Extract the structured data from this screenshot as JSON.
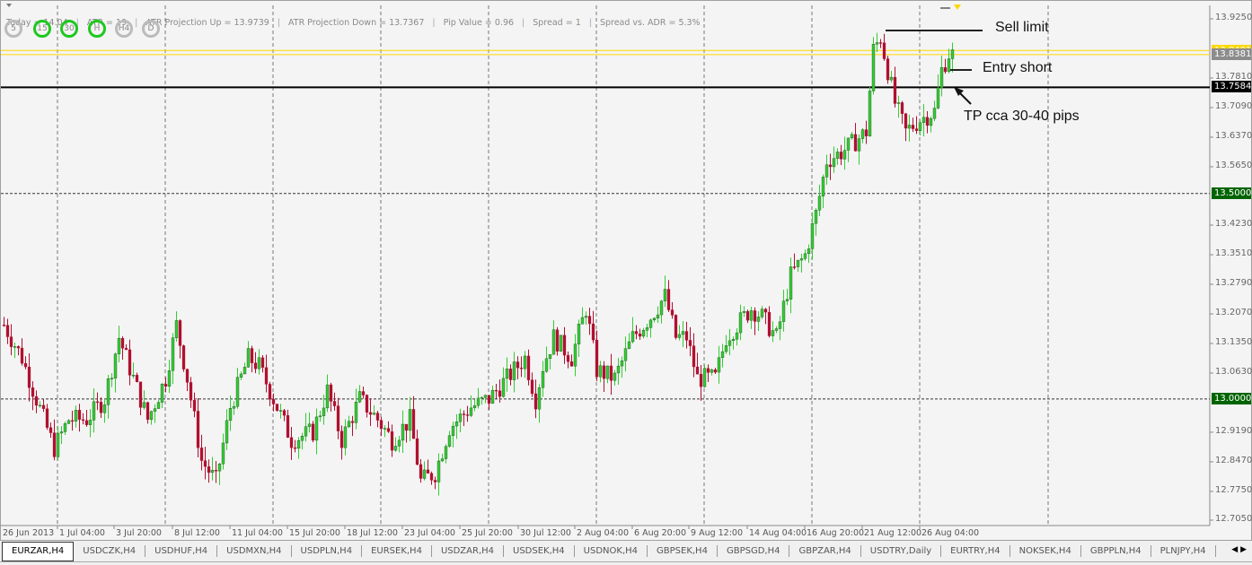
{
  "info_bar": {
    "today": "Today = 14.04",
    "atr": "ATR = 19",
    "atr_up": "ATR Projection Up = 13.9739",
    "atr_down": "ATR Projection Down = 13.7367",
    "pip_value": "Pip Value = 0.96",
    "spread": "Spread = 1",
    "spread_adr": "Spread vs. ADR = 5.3%"
  },
  "timeframes": [
    {
      "label": "5",
      "active": false
    },
    {
      "label": "15",
      "active": true
    },
    {
      "label": "30",
      "active": true
    },
    {
      "label": "H",
      "active": true
    },
    {
      "label": "H4",
      "active": false
    },
    {
      "label": "D",
      "active": false
    }
  ],
  "price_axis": [
    "13.9250",
    "13.7810",
    "13.7090",
    "13.6370",
    "13.5650",
    "13.4230",
    "13.3510",
    "13.2790",
    "13.2070",
    "13.1350",
    "13.0630",
    "12.9190",
    "12.8470",
    "12.7750",
    "12.7050"
  ],
  "price_markers": {
    "ask": "13.8481",
    "bid": "13.8381",
    "tp": "13.7584",
    "level_1": "13.5000",
    "level_2": "13.0000"
  },
  "time_axis": [
    "26 Jun 2013",
    "1 Jul 04:00",
    "3 Jul 20:00",
    "8 Jul 12:00",
    "11 Jul 04:00",
    "15 Jul 20:00",
    "18 Jul 12:00",
    "23 Jul 04:00",
    "25 Jul 20:00",
    "30 Jul 12:00",
    "2 Aug 04:00",
    "6 Aug 20:00",
    "9 Aug 12:00",
    "14 Aug 04:00",
    "16 Aug 20:00",
    "21 Aug 12:00",
    "26 Aug 04:00"
  ],
  "annotations": {
    "sell_limit": "Sell limit",
    "entry_short": "Entry short",
    "tp": "TP cca 30-40 pips"
  },
  "colors": {
    "bull": "#32cd32",
    "bear": "#b01030",
    "ask_line": "#ffd700",
    "tp_line": "#000000",
    "level_bg": "#006400"
  },
  "tabs": [
    "EURZAR,H4",
    "USDCZK,H4",
    "USDHUF,H4",
    "USDMXN,H4",
    "USDPLN,H4",
    "EURSEK,H4",
    "USDZAR,H4",
    "USDSEK,H4",
    "USDNOK,H4",
    "GBPSEK,H4",
    "GBPSGD,H4",
    "GBPZAR,H4",
    "USDTRY,Daily",
    "EURTRY,H4",
    "NOKSEK,H4",
    "GBPPLN,H4",
    "PLNJPY,H4"
  ],
  "chart_data": {
    "type": "candlestick",
    "symbol": "EURZAR",
    "timeframe": "H4",
    "ylim": [
      12.705,
      13.925
    ],
    "close_path": [
      [
        0,
        13.18
      ],
      [
        5,
        13.1
      ],
      [
        9,
        13.0
      ],
      [
        14,
        12.88
      ],
      [
        18,
        12.95
      ],
      [
        23,
        12.95
      ],
      [
        28,
        13.0
      ],
      [
        32,
        13.15
      ],
      [
        36,
        13.05
      ],
      [
        40,
        12.95
      ],
      [
        45,
        13.05
      ],
      [
        48,
        13.18
      ],
      [
        51,
        13.05
      ],
      [
        55,
        12.85
      ],
      [
        59,
        12.8
      ],
      [
        63,
        12.98
      ],
      [
        68,
        13.1
      ],
      [
        71,
        13.08
      ],
      [
        75,
        13.0
      ],
      [
        80,
        12.9
      ],
      [
        86,
        12.92
      ],
      [
        90,
        13.02
      ],
      [
        94,
        12.9
      ],
      [
        99,
        13.0
      ],
      [
        104,
        12.95
      ],
      [
        108,
        12.9
      ],
      [
        113,
        12.95
      ],
      [
        116,
        12.8
      ],
      [
        120,
        12.82
      ],
      [
        124,
        12.93
      ],
      [
        130,
        12.98
      ],
      [
        135,
        13.0
      ],
      [
        140,
        13.05
      ],
      [
        145,
        13.1
      ],
      [
        148,
        13.0
      ],
      [
        150,
        13.08
      ],
      [
        153,
        13.15
      ],
      [
        158,
        13.1
      ],
      [
        162,
        13.22
      ],
      [
        165,
        13.07
      ],
      [
        170,
        13.05
      ],
      [
        175,
        13.15
      ],
      [
        180,
        13.2
      ],
      [
        184,
        13.25
      ],
      [
        187,
        13.15
      ],
      [
        190,
        13.15
      ],
      [
        193,
        13.05
      ],
      [
        198,
        13.05
      ],
      [
        201,
        13.15
      ],
      [
        208,
        13.22
      ],
      [
        211,
        13.2
      ],
      [
        215,
        13.15
      ],
      [
        219,
        13.3
      ],
      [
        223,
        13.35
      ],
      [
        226,
        13.45
      ],
      [
        229,
        13.58
      ],
      [
        233,
        13.6
      ],
      [
        236,
        13.62
      ],
      [
        240,
        13.65
      ],
      [
        242,
        13.85
      ],
      [
        244,
        13.88
      ],
      [
        248,
        13.72
      ],
      [
        251,
        13.65
      ],
      [
        255,
        13.68
      ],
      [
        259,
        13.7
      ],
      [
        261,
        13.8
      ],
      [
        263,
        13.84
      ],
      [
        264,
        13.838
      ]
    ]
  }
}
